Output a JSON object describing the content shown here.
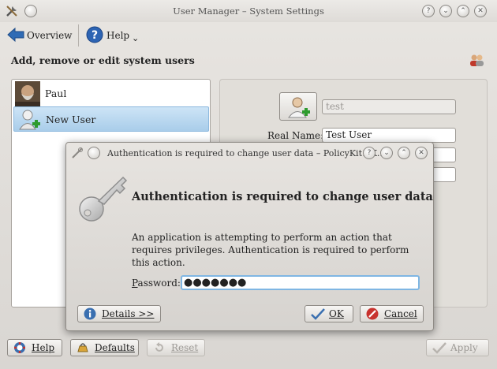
{
  "window": {
    "title": "User Manager – System Settings"
  },
  "toolbar": {
    "overview_label": "Overview",
    "help_label": "Help"
  },
  "page_heading": "Add, remove or edit system users",
  "users": [
    {
      "name": "Paul"
    },
    {
      "name": "New User"
    }
  ],
  "details": {
    "username_value": "test",
    "real_name_label": "Real Name:",
    "real_name_value": "Test User"
  },
  "bottom_buttons": {
    "help": "Help",
    "defaults": "Defaults",
    "reset": "Reset",
    "apply": "Apply"
  },
  "dialog": {
    "title": "Authentication is required to change user data – PolicyKit1-K...",
    "heading": "Authentication is required to change user data",
    "message": "An application is attempting to perform an action that requires privileges. Authentication is required to perform this action.",
    "password_label": "Password:",
    "password_value": "●●●●●●●",
    "details_button": "Details >>",
    "ok_button": "OK",
    "cancel_button": "Cancel"
  },
  "colors": {
    "accent": "#7fb6e3",
    "selection": "#b7d6ef",
    "cancel_red": "#c8322e",
    "ok_blue": "#3a6fb0"
  }
}
